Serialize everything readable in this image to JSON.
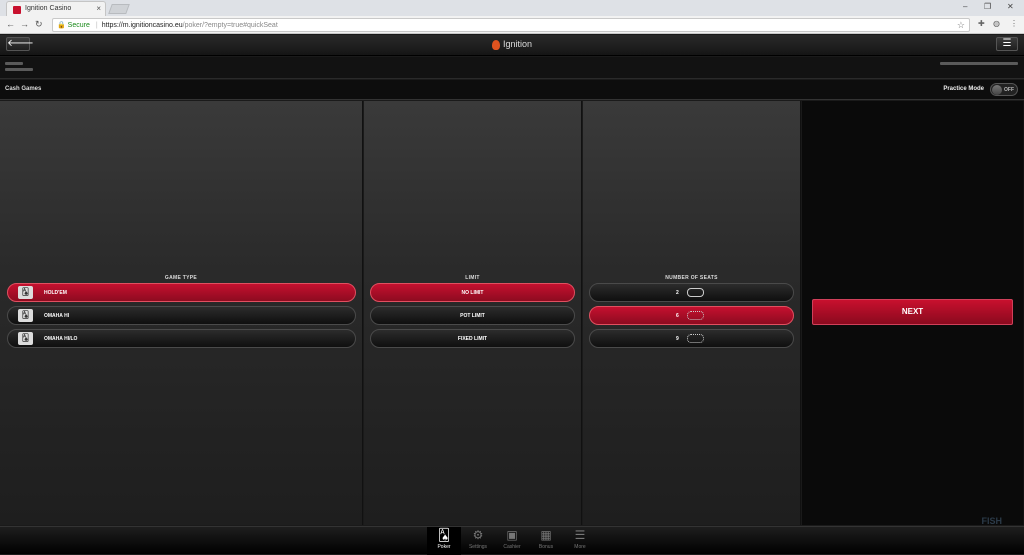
{
  "browser": {
    "tab_title": "Ignition Casino",
    "tab_close": "×",
    "url_secure": "Secure",
    "url_host": "https://m.ignitioncasino.eu",
    "url_path": "/poker/?empty=true#quickSeat"
  },
  "app": {
    "logo_text": "Ignition",
    "back_glyph": "🡐",
    "menu_glyph": "☰"
  },
  "section": {
    "title": "Cash Games",
    "practice_label": "Practice Mode",
    "toggle_state": "OFF"
  },
  "game_type": {
    "heading": "GAME TYPE",
    "options": [
      {
        "label": "HOLD'EM",
        "selected": true
      },
      {
        "label": "OMAHA HI",
        "selected": false
      },
      {
        "label": "OMAHA HI/LO",
        "selected": false
      }
    ]
  },
  "limit": {
    "heading": "LIMIT",
    "options": [
      {
        "label": "NO LIMIT",
        "selected": true
      },
      {
        "label": "POT LIMIT",
        "selected": false
      },
      {
        "label": "FIXED LIMIT",
        "selected": false
      }
    ]
  },
  "seats": {
    "heading": "NUMBER OF SEATS",
    "options": [
      {
        "label": "2",
        "selected": false
      },
      {
        "label": "6",
        "selected": true
      },
      {
        "label": "9",
        "selected": false
      }
    ]
  },
  "next_label": "NEXT",
  "bottom_nav": [
    {
      "label": "Poker",
      "icon": "cards-icon",
      "active": true
    },
    {
      "label": "Settings",
      "icon": "gear-icon",
      "active": false
    },
    {
      "label": "Cashier",
      "icon": "cashier-icon",
      "active": false
    },
    {
      "label": "Bonus",
      "icon": "gift-icon",
      "active": false
    },
    {
      "label": "More",
      "icon": "list-icon",
      "active": false
    }
  ],
  "watermark": "FISH"
}
